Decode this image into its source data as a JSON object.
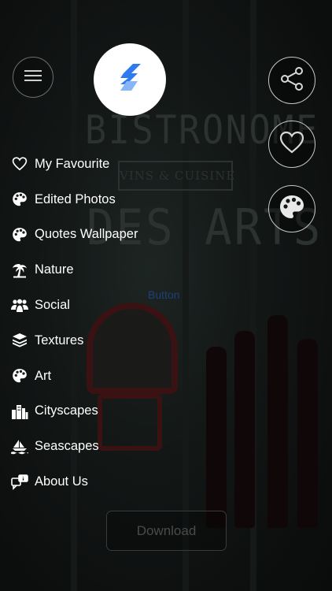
{
  "background_sign": {
    "line1": "BISTRONOME",
    "badge": "VINS & CUISINE",
    "line2": "DES ARTS"
  },
  "app_icon": {
    "icon": "app-logo-icon",
    "color": "#2e7bf0"
  },
  "menu_button": {
    "icon": "hamburger-icon"
  },
  "actions": [
    {
      "icon": "share-icon"
    },
    {
      "icon": "heart-icon"
    },
    {
      "icon": "palette-icon"
    }
  ],
  "menu": {
    "items": [
      {
        "label": "My Favourite",
        "icon": "heart-outline-icon"
      },
      {
        "label": "Edited Photos",
        "icon": "palette-icon"
      },
      {
        "label": "Quotes Wallpaper",
        "icon": "palette-icon"
      },
      {
        "label": "Nature",
        "icon": "palm-tree-icon"
      },
      {
        "label": "Social",
        "icon": "people-icon"
      },
      {
        "label": "Textures",
        "icon": "layers-icon"
      },
      {
        "label": "Art",
        "icon": "palette-icon"
      },
      {
        "label": "Cityscapes",
        "icon": "city-icon"
      },
      {
        "label": "Seascapes",
        "icon": "sea-icon"
      },
      {
        "label": "About Us",
        "icon": "info-chat-icon"
      }
    ]
  },
  "placeholder_button": {
    "label": "Button"
  },
  "download_button": {
    "label": "Download"
  }
}
